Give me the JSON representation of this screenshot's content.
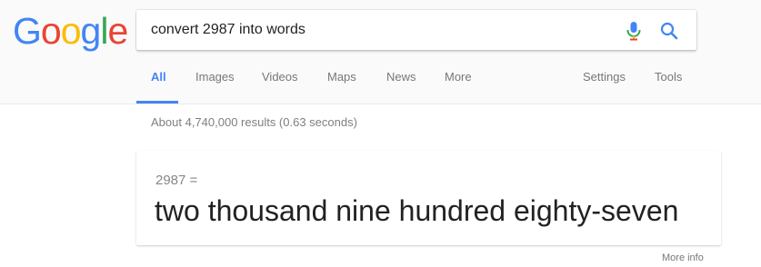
{
  "logo": {
    "letters": [
      "G",
      "o",
      "o",
      "g",
      "l",
      "e"
    ],
    "colors": [
      "#4285f4",
      "#ea4335",
      "#fbbc05",
      "#4285f4",
      "#34a853",
      "#ea4335"
    ]
  },
  "search": {
    "query": "convert 2987 into words",
    "mic_icon": "microphone-icon",
    "search_icon": "magnifier-icon"
  },
  "tabs": {
    "all": "All",
    "images": "Images",
    "videos": "Videos",
    "maps": "Maps",
    "news": "News",
    "more": "More",
    "settings": "Settings",
    "tools": "Tools",
    "active": "All"
  },
  "results": {
    "stats": "About 4,740,000 results (0.63 seconds)"
  },
  "answer_card": {
    "expression": "2987 =",
    "result": "two thousand nine hundred eighty-seven",
    "more_info": "More info"
  },
  "colors": {
    "accent": "#4285f4",
    "header_bg": "#fafafa"
  }
}
